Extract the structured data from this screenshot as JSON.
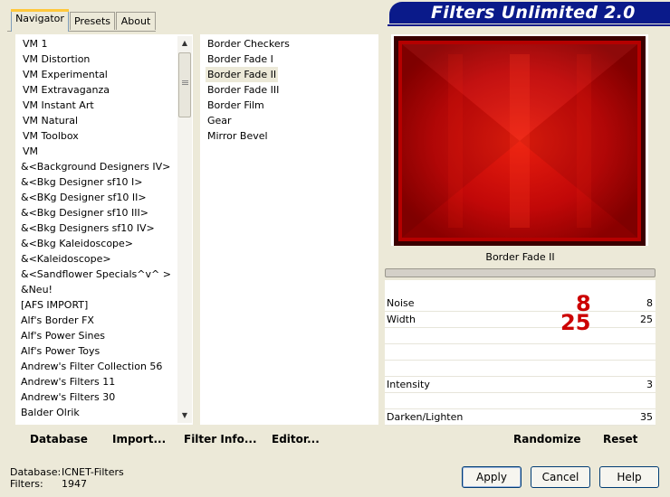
{
  "tabs": [
    "Navigator",
    "Presets",
    "About"
  ],
  "title": "Filters Unlimited 2.0",
  "categories": [
    "VM 1",
    "VM Distortion",
    "VM Experimental",
    "VM Extravaganza",
    "VM Instant Art",
    "VM Natural",
    "VM Toolbox",
    "VM",
    "&<Background Designers IV>",
    "&<Bkg Designer sf10 I>",
    "&<BKg Designer sf10 II>",
    "&<Bkg Designer sf10 III>",
    "&<Bkg Designers sf10 IV>",
    "&<Bkg Kaleidoscope>",
    "&<Kaleidoscope>",
    "&<Sandflower Specials^v^ >",
    "&Neu!",
    "[AFS IMPORT]",
    "Alf's Border FX",
    "Alf's Power Sines",
    "Alf's Power Toys",
    "Andrew's Filter Collection 56",
    "Andrew's Filters 11",
    "Andrew's Filters 30",
    "Balder Olrik"
  ],
  "filters": [
    "Border Checkers",
    "Border Fade I",
    "Border Fade II",
    "Border Fade III",
    "Border Film",
    "Gear",
    "Mirror Bevel"
  ],
  "selected_filter": "Border Fade II",
  "params": [
    {
      "label": "Noise",
      "value": "8"
    },
    {
      "label": "Width",
      "value": "25"
    },
    {
      "label": "",
      "value": ""
    },
    {
      "label": "",
      "value": ""
    },
    {
      "label": "",
      "value": ""
    },
    {
      "label": "Intensity",
      "value": "3"
    },
    {
      "label": "",
      "value": ""
    },
    {
      "label": "Darken/Lighten",
      "value": "35"
    }
  ],
  "annotations": [
    "8",
    "25"
  ],
  "toolbar": {
    "database": "Database",
    "import": "Import...",
    "filter_info": "Filter Info...",
    "editor": "Editor...",
    "randomize": "Randomize",
    "reset": "Reset"
  },
  "status": {
    "database_label": "Database:",
    "database_value": "ICNET-Filters",
    "filters_label": "Filters:",
    "filters_value": "1947"
  },
  "buttons": {
    "apply": "Apply",
    "cancel": "Cancel",
    "help": "Help"
  },
  "colors": {
    "accent_banner": "#0a1a8a",
    "annotation": "#cc0000",
    "preview": "#b00000"
  }
}
